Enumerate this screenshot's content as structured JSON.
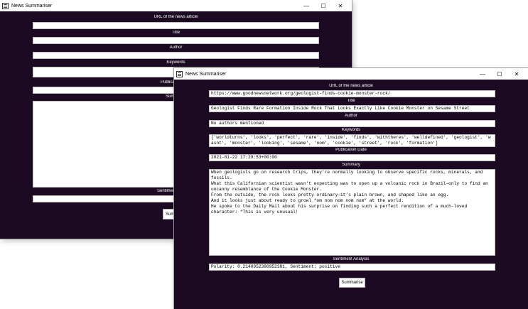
{
  "back_window": {
    "title": "News Summariser",
    "labels": {
      "url": "URL of the news article",
      "title": "Title",
      "author": "Author",
      "keywords": "Keywords",
      "publication": "Publica",
      "summary": "Sum",
      "sentiment": "Sentimen"
    },
    "summarise_label": "Sumn",
    "controls": {
      "minimize": "—",
      "maximize": "☐",
      "close": "✕"
    }
  },
  "front_window": {
    "title": "News Summariser",
    "controls": {
      "minimize": "—",
      "maximize": "☐",
      "close": "✕"
    },
    "fields": {
      "url": {
        "label": "URL of the news article",
        "value": "https://www.goodnewsnetwork.org/geologist-finds-cookie-monster-rock/"
      },
      "title": {
        "label": "Title",
        "value": "Geologist Finds Rare Formation Inside Rock That Looks Exactly Like Cookie Monster on Sesame Street"
      },
      "author": {
        "label": "Author",
        "value": "No authors mentioned"
      },
      "keywords": {
        "label": "Keywords",
        "value": "['worldturns', 'looks', 'perfect', 'rare', 'inside', 'finds', 'withtheres', 'welldefined', 'geologist', 'wasnt', 'monster', 'looking', 'sesame', 'nom', 'cookie', 'street', 'rock', 'formation']"
      },
      "publication_date": {
        "label": "Publication Date",
        "value": "2021-01-22 17:29:53+00:00"
      },
      "summary": {
        "label": "Summary",
        "value": "When geologists go on research trips, they’re normally looking to observe specific rocks, minerals, and fossils.\nWhat this Californian scientist wasn’t expecting was to open up a volcanic rock in Brazil—only to find an uncanny resemblance of the Cookie Monster.\nFrom the outside, the rock looks pretty ordinary—it’s plain brown, and shaped like an egg.\nAnd it looks just about ready to growl “om nom nom nom nom” at the world.\nHe spoke to the Daily Mail about his surprise on finding such a perfect rendition of a much-loved character: “This is very unusual!"
      },
      "sentiment": {
        "label": "Sentiment Analysis",
        "value": "Polarity: 0.2140952380952381, Sentiment: positive"
      }
    },
    "summarise_label": "Summarise"
  }
}
